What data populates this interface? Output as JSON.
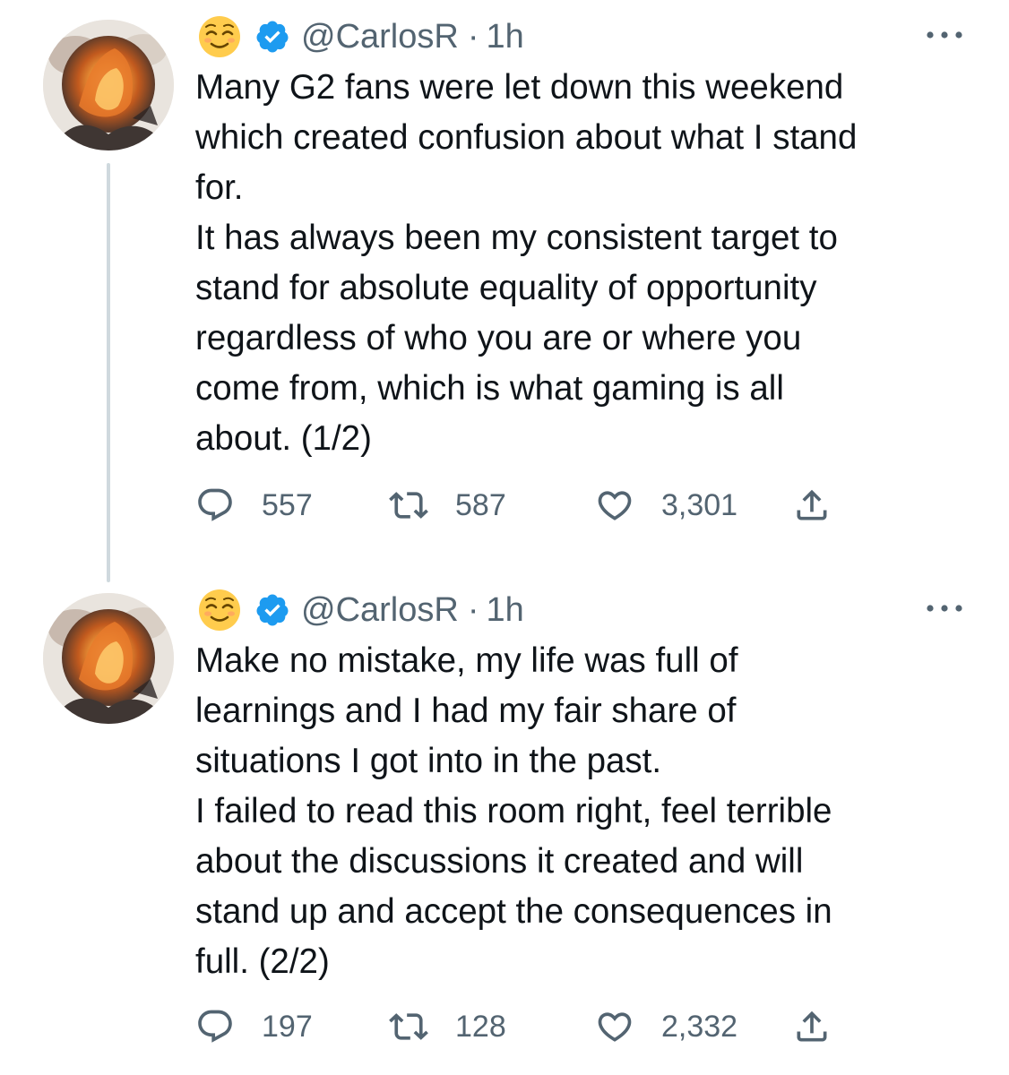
{
  "tweets": [
    {
      "emoji": "relieved-face",
      "handle": "@CarlosR",
      "separator": "·",
      "time": "1h",
      "lines": [
        "Many G2 fans were let down this weekend",
        "which created confusion about what I stand",
        "for.",
        "It has always been my consistent target to",
        "stand for absolute equality of opportunity",
        "regardless of who you are or where you",
        "come from, which is what gaming is all",
        "about. (1/2)"
      ],
      "replies": "557",
      "retweets": "587",
      "likes": "3,301"
    },
    {
      "emoji": "relieved-face",
      "handle": "@CarlosR",
      "separator": "·",
      "time": "1h",
      "lines": [
        "Make no mistake, my life was full of",
        "learnings and I had my fair share of",
        "situations I got into in the past.",
        "I failed to read this room right, feel terrible",
        "about the discussions it created and will",
        "stand up and accept the consequences in",
        "full. (2/2)"
      ],
      "replies": "197",
      "retweets": "128",
      "likes": "2,332"
    }
  ],
  "colors": {
    "text": "#0f1419",
    "secondary": "#536471",
    "verified": "#1d9bf0",
    "thread_line": "#cfd9de",
    "background": "#ffffff"
  },
  "icons": [
    "relieved-face-emoji",
    "verified-badge-icon",
    "more-options-icon",
    "reply-icon",
    "retweet-icon",
    "like-icon",
    "share-icon"
  ]
}
